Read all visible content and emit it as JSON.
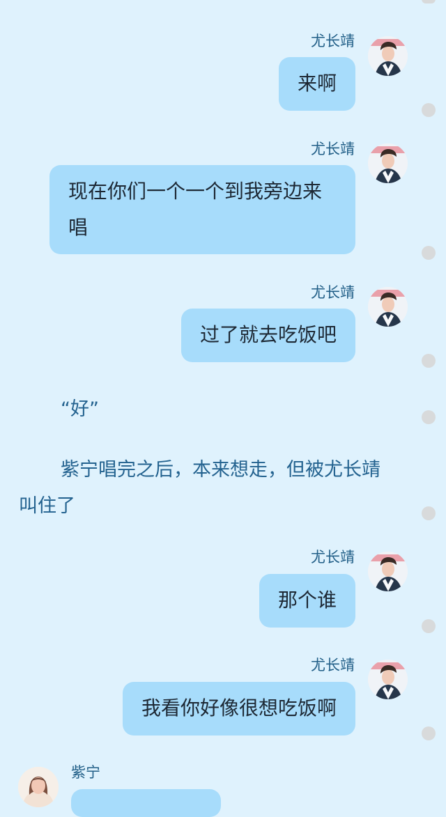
{
  "messages": [
    {
      "sender": "尤长靖",
      "text": "来啊"
    },
    {
      "sender": "尤长靖",
      "text": "现在你们一个一个到我旁边来唱"
    },
    {
      "sender": "尤长靖",
      "text": "过了就去吃饭吧"
    },
    {
      "sender": "尤长靖",
      "text": "那个谁"
    },
    {
      "sender": "尤长靖",
      "text": "我看你好像很想吃饭啊"
    }
  ],
  "narration": {
    "line1": "“好”",
    "line2": "紫宁唱完之后，本来想走，但被尤长靖叫住了"
  },
  "incoming": {
    "sender": "紫宁"
  },
  "icons": {
    "avatar_right": "avatar-photo",
    "avatar_left": "avatar-photo",
    "side_markers": "dot"
  },
  "colors": {
    "background": "#dff2fd",
    "bubble": "#a7dcfb",
    "name_text": "#1f5d86",
    "body_text": "#1d2834",
    "narration_text": "#23628f",
    "marker": "#d8dadb"
  }
}
